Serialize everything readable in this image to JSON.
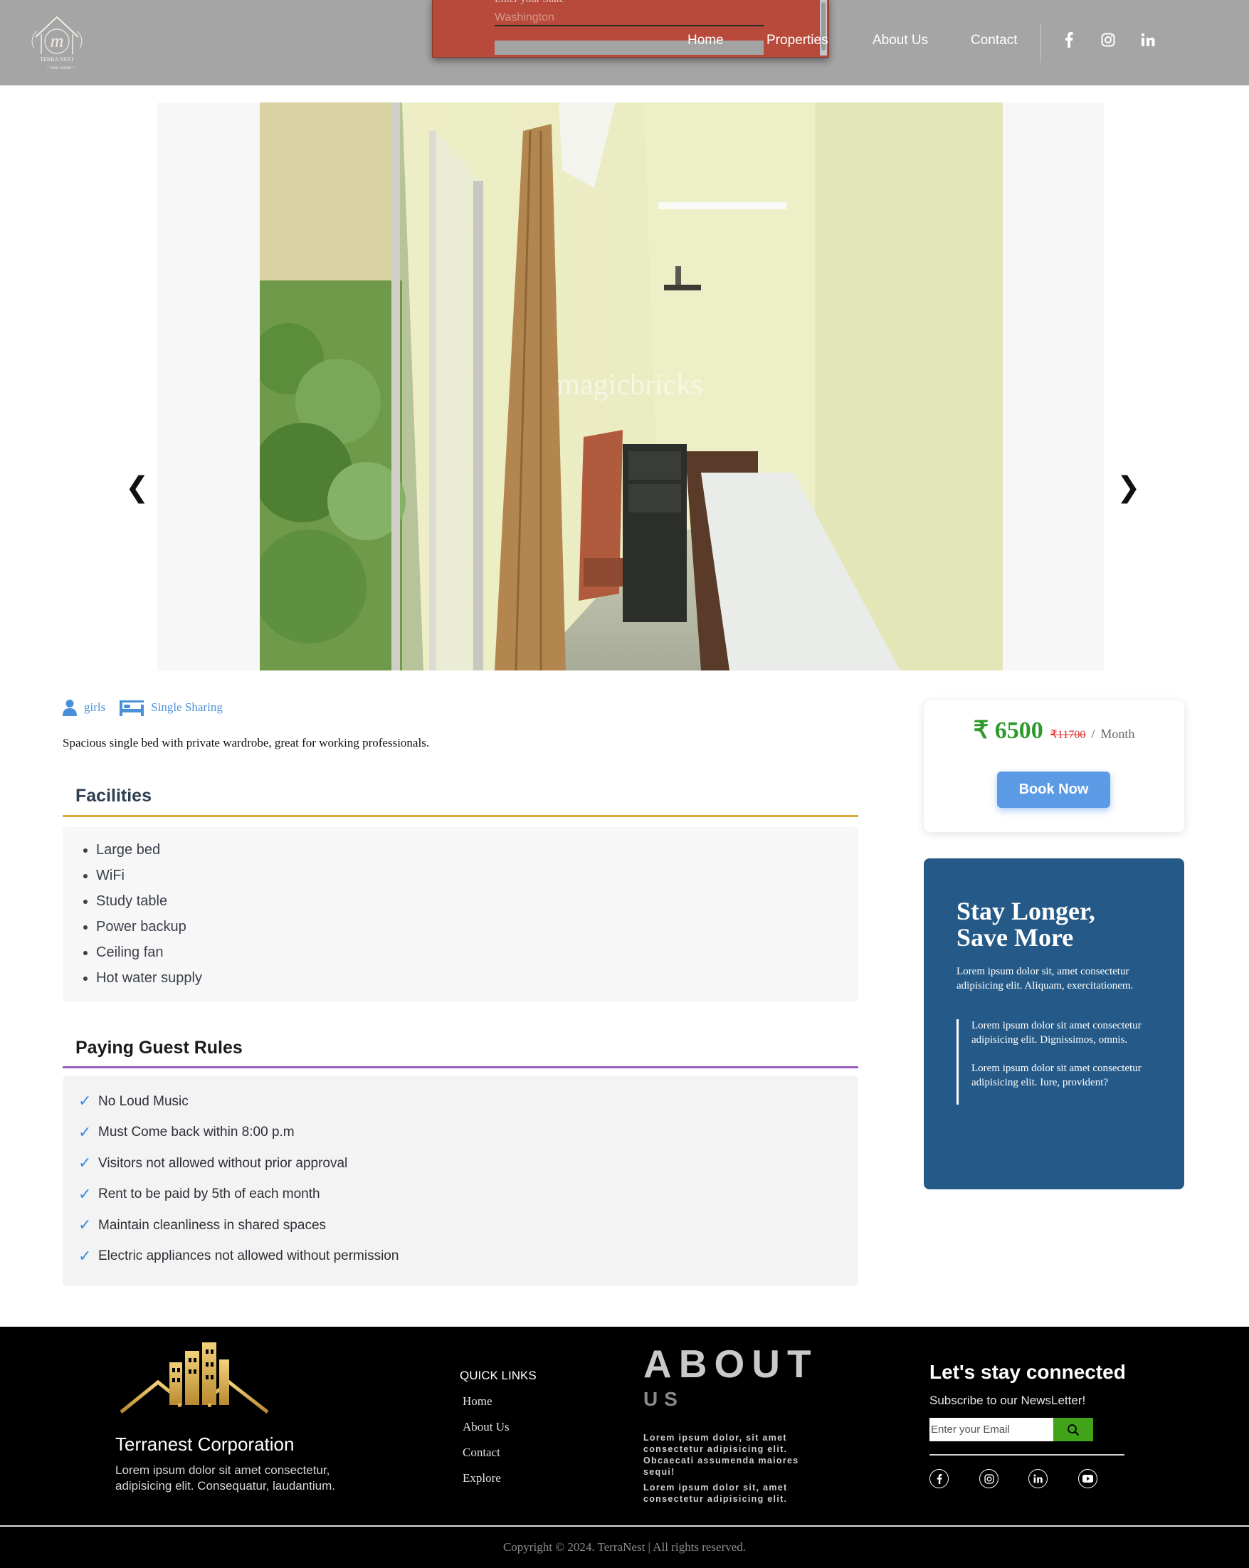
{
  "header": {
    "logo_alt": "TERRA NEST",
    "nav": [
      "Home",
      "Properties",
      "About Us",
      "Contact"
    ],
    "social_icons": [
      "facebook-icon",
      "instagram-icon",
      "linkedin-icon"
    ],
    "popup": {
      "label": "Enter your State",
      "input_placeholder": "Washington"
    }
  },
  "carousel": {
    "prev_label": "❮",
    "next_label": "❯",
    "watermark": "magicbricks"
  },
  "listing": {
    "gender": "girls",
    "sharing": "Single Sharing",
    "description": "Spacious single bed with private wardrobe, great for working professionals."
  },
  "facilities": {
    "title": "Facilities",
    "items": [
      "Large bed",
      "WiFi",
      "Study table",
      "Power backup",
      "Ceiling fan",
      "Hot water supply"
    ]
  },
  "rules": {
    "title": "Paying Guest Rules",
    "items": [
      "No Loud Music",
      "Must Come back within 8:00 p.m",
      "Visitors not allowed without prior approval",
      "Rent to be paid by 5th of each month",
      "Maintain cleanliness in shared spaces",
      "Electric appliances not allowed without permission"
    ]
  },
  "price": {
    "amount": "₹ 6500",
    "original": "₹11700",
    "separator": "/",
    "period": "Month",
    "book_label": "Book Now"
  },
  "promo": {
    "title": "Stay Longer, Save More",
    "text": "Lorem ipsum dolor sit, amet consectetur adipisicing elit. Aliquam, exercitationem.",
    "quotes": [
      "Lorem ipsum dolor sit amet consectetur adipisicing elit. Dignissimos, omnis.",
      "Lorem ipsum dolor sit amet consectetur adipisicing elit. Iure, provident?"
    ]
  },
  "footer": {
    "corp_name": "Terranest Corporation",
    "corp_text": "Lorem ipsum dolor sit amet consectetur, adipisicing elit. Consequatur, laudantium.",
    "quick_links_title": "QUICK LINKS",
    "quick_links": [
      "Home",
      "About Us",
      "Contact",
      "Explore"
    ],
    "about_title": "ABOUT",
    "about_sub": "US",
    "about_paragraphs": [
      "Lorem ipsum dolor, sit amet consectetur adipisicing elit. Obcaecati assumenda maiores sequi!",
      "Lorem ipsum dolor sit, amet consectetur adipisicing elit."
    ],
    "stay_title": "Let's stay connected",
    "subscribe_text": "Subscribe to our NewsLetter!",
    "email_placeholder": "Enter your Email",
    "social_icons": [
      "facebook-icon",
      "instagram-icon",
      "linkedin-icon",
      "youtube-icon"
    ],
    "copyright": "Copyright © 2024. TerraNest | All rights reserved."
  },
  "colors": {
    "header_bg": "#a5a5a5",
    "accent_blue": "#5b9be6",
    "price_green": "#2e9a2e",
    "promo_bg": "#255a88",
    "facilities_rule": "#d4a93c",
    "rules_rule": "#9b5fc0"
  }
}
